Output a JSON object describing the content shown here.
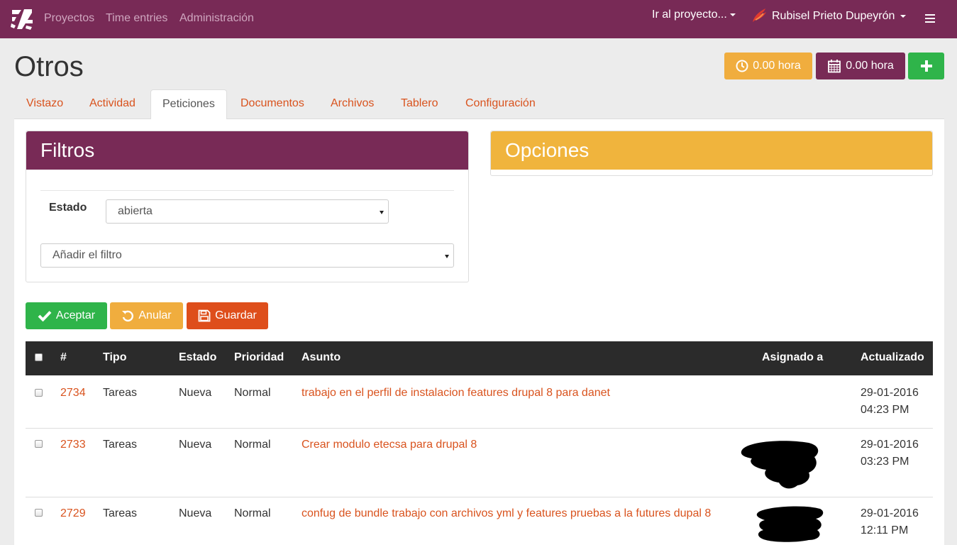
{
  "nav": {
    "links": [
      "Proyectos",
      "Time entries",
      "Administración"
    ],
    "project_jump": "Ir al proyecto...",
    "user": "Rubisel Prieto Dupeyrón"
  },
  "header": {
    "title": "Otros",
    "time_spent": "0.00 hora",
    "time_logged": "0.00 hora"
  },
  "tabs": [
    "Vistazo",
    "Actividad",
    "Peticiones",
    "Documentos",
    "Archivos",
    "Tablero",
    "Configuración"
  ],
  "filters": {
    "title": "Filtros",
    "status_label": "Estado",
    "status_value": "abierta",
    "add_filter": "Añadir el filtro"
  },
  "options": {
    "title": "Opciones"
  },
  "actions": {
    "accept": "Aceptar",
    "reset": "Anular",
    "save": "Guardar"
  },
  "table": {
    "columns": [
      "#",
      "Tipo",
      "Estado",
      "Prioridad",
      "Asunto",
      "Asignado a",
      "Actualizado"
    ],
    "rows": [
      {
        "id": "2734",
        "tipo": "Tareas",
        "estado": "Nueva",
        "prioridad": "Normal",
        "asunto": "trabajo en el perfil de instalacion features drupal 8 para danet",
        "date": "29-01-2016",
        "time": "04:23 PM"
      },
      {
        "id": "2733",
        "tipo": "Tareas",
        "estado": "Nueva",
        "prioridad": "Normal",
        "asunto": "Crear modulo etecsa para drupal 8",
        "date": "29-01-2016",
        "time": "03:23 PM"
      },
      {
        "id": "2729",
        "tipo": "Tareas",
        "estado": "Nueva",
        "prioridad": "Normal",
        "asunto": "confug de bundle trabajo con archivos yml y features pruebas a la futures dupal 8",
        "date": "29-01-2016",
        "time": "12:11 PM"
      }
    ]
  },
  "colors": {
    "brand": "#782a56",
    "warning": "#f0ad3e",
    "success": "#2fb44a",
    "danger": "#de4e1b",
    "link": "#d9531e"
  }
}
